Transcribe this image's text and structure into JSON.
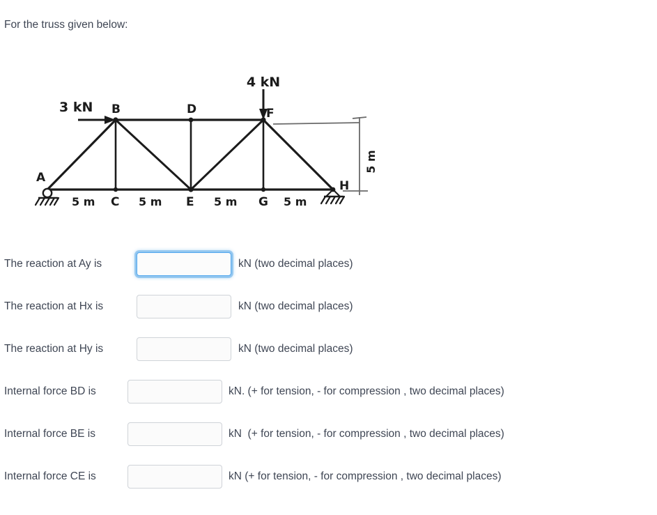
{
  "prompt": "For the truss given below:",
  "figure": {
    "title": "truss-diagram",
    "loads": [
      {
        "label": "3 kN",
        "at_node": "B",
        "direction": "right"
      },
      {
        "label": "4 kN",
        "at_node": "F",
        "direction": "down"
      }
    ],
    "node_labels": [
      "A",
      "B",
      "C",
      "D",
      "E",
      "F",
      "G",
      "H"
    ],
    "bottom_dimensions": [
      "5 m",
      "5 m",
      "5 m",
      "5 m"
    ],
    "height_dimension": "5 m",
    "supports": [
      {
        "node": "A",
        "type": "pin"
      },
      {
        "node": "H",
        "type": "pin"
      }
    ],
    "stroke_color": "#1b1b1b"
  },
  "questions": [
    {
      "id": "ay",
      "label": "The reaction at Ay is",
      "value": "",
      "placeholder": "",
      "suffix": "kN (two decimal places)",
      "focused": true
    },
    {
      "id": "hx",
      "label": "The reaction at Hx is",
      "value": "",
      "placeholder": "",
      "suffix": "kN (two decimal places)",
      "focused": false
    },
    {
      "id": "hy",
      "label": "The reaction at Hy is",
      "value": "",
      "placeholder": "",
      "suffix": "kN (two decimal places)",
      "focused": false
    },
    {
      "id": "bd",
      "label": "Internal force BD is",
      "value": "",
      "placeholder": "",
      "suffix": "kN. (+ for tension, - for compression , two decimal places)",
      "focused": false
    },
    {
      "id": "be",
      "label": "Internal force BE is",
      "value": "",
      "placeholder": "",
      "suffix": "kN  (+ for tension, - for compression , two decimal places)",
      "focused": false
    },
    {
      "id": "ce",
      "label": "Internal force CE is",
      "value": "",
      "placeholder": "",
      "suffix": "kN (+ for tension, - for compression , two decimal places)",
      "focused": false
    }
  ],
  "colors": {
    "text": "#3f4654",
    "field_border": "#cfd3d8",
    "focus_ring": "#54a8ef",
    "ink": "#1b1b1b",
    "background": "#ffffff"
  }
}
